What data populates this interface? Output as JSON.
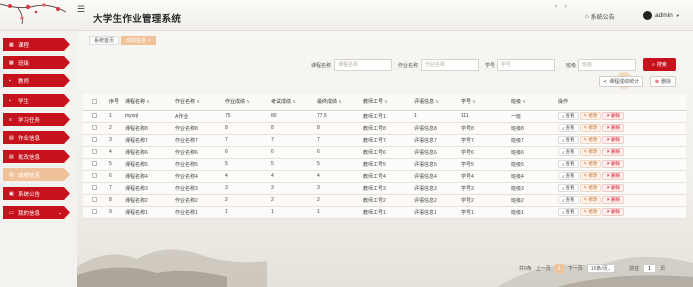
{
  "header": {
    "menu_icon": "hamburger-icon",
    "title": "大学生作业管理系统",
    "notice_label": "系统公告",
    "user_name": "admin"
  },
  "sidebar": {
    "items": [
      {
        "label": "课程",
        "icon": "grid-icon"
      },
      {
        "label": "班级",
        "icon": "grid-icon"
      },
      {
        "label": "教师",
        "icon": "user-icon"
      },
      {
        "label": "学生",
        "icon": "user-icon"
      },
      {
        "label": "学习任务",
        "icon": "list-icon"
      },
      {
        "label": "作业信息",
        "icon": "doc-icon"
      },
      {
        "label": "批改信息",
        "icon": "doc-icon"
      },
      {
        "label": "成绩信息",
        "icon": "doc-icon"
      },
      {
        "label": "系统公告",
        "icon": "notice-icon"
      },
      {
        "label": "我的信息",
        "icon": "profile-icon"
      }
    ],
    "active_index": 7
  },
  "tabs": [
    {
      "label": "系统首页"
    },
    {
      "label": "成绩信息",
      "close": "×"
    }
  ],
  "filters": {
    "course": {
      "label": "课程名称",
      "placeholder": "课程名称"
    },
    "homework": {
      "label": "作业名称",
      "placeholder": "作业名称"
    },
    "student": {
      "label": "学号",
      "placeholder": "学号"
    },
    "class": {
      "label": "班级",
      "placeholder": "班级"
    },
    "search_label": "搜索",
    "stat_label": "课程成绩统计",
    "delete_label": "删除"
  },
  "table": {
    "columns": [
      "序号",
      "课程名称",
      "作业名称",
      "作业成绩",
      "考试成绩",
      "最终成绩",
      "教师工号",
      "评语信息",
      "学号",
      "班级",
      "操作"
    ],
    "rows": [
      [
        "1",
        "mysql",
        "A作业",
        "75",
        "80",
        "77.5",
        "教师工号1",
        "1",
        "111",
        "一班"
      ],
      [
        "2",
        "课程名称8",
        "作业名称8",
        "8",
        "8",
        "8",
        "教师工号8",
        "评语信息8",
        "学号8",
        "班级8"
      ],
      [
        "3",
        "课程名称7",
        "作业名称7",
        "7",
        "7",
        "7",
        "教师工号7",
        "评语信息7",
        "学号7",
        "班级7"
      ],
      [
        "4",
        "课程名称6",
        "作业名称6",
        "6",
        "6",
        "6",
        "教师工号6",
        "评语信息6",
        "学号6",
        "班级6"
      ],
      [
        "5",
        "课程名称5",
        "作业名称5",
        "5",
        "5",
        "5",
        "教师工号5",
        "评语信息5",
        "学号5",
        "班级5"
      ],
      [
        "6",
        "课程名称4",
        "作业名称4",
        "4",
        "4",
        "4",
        "教师工号4",
        "评语信息4",
        "学号4",
        "班级4"
      ],
      [
        "7",
        "课程名称3",
        "作业名称3",
        "3",
        "3",
        "3",
        "教师工号3",
        "评语信息3",
        "学号3",
        "班级3"
      ],
      [
        "8",
        "课程名称2",
        "作业名称2",
        "2",
        "2",
        "2",
        "教师工号2",
        "评语信息2",
        "学号2",
        "班级2"
      ],
      [
        "9",
        "课程名称1",
        "作业名称1",
        "1",
        "1",
        "1",
        "教师工号1",
        "评语信息1",
        "学号1",
        "班级1"
      ]
    ],
    "actions": {
      "view": "查看",
      "edit": "修改",
      "delete": "删除"
    }
  },
  "pagination": {
    "total": "共9条",
    "prev": "上一页",
    "current": "1",
    "next": "下一页",
    "page_size": "10条/页",
    "goto_label": "前往",
    "goto_value": "1",
    "page_unit": "页"
  },
  "colors": {
    "brand_red": "#c5121c",
    "active_peach": "#f0c29a"
  }
}
